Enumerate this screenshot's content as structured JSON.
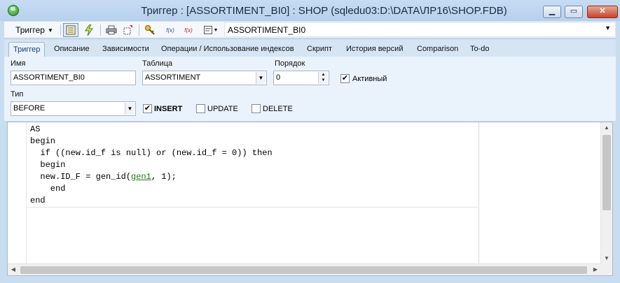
{
  "window": {
    "title": "Триггер : [ASSORTIMENT_BI0] : SHOP (sqledu03:D:\\DATA\\ЛР16\\SHOP.FDB)",
    "min_glyph": "▁",
    "max_glyph": "▭",
    "close_glyph": "✕"
  },
  "toolbar": {
    "trigger_menu_label": "Триггер",
    "object_selector_value": "ASSORTIMENT_BI0",
    "f1_glyph": "f(x)",
    "f2_glyph": "f(x)"
  },
  "tabs": [
    {
      "label": "Триггер",
      "active": true
    },
    {
      "label": "Описание"
    },
    {
      "label": "Зависимости"
    },
    {
      "label": "Операции / Использование индексов"
    },
    {
      "label": "Скрипт"
    },
    {
      "label": "История версий"
    },
    {
      "label": "Comparison"
    },
    {
      "label": "To-do"
    }
  ],
  "form": {
    "name_label": "Имя",
    "name_value": "ASSORTIMENT_BI0",
    "table_label": "Таблица",
    "table_value": "ASSORTIMENT",
    "order_label": "Порядок",
    "order_value": "0",
    "active_label": "Активный",
    "active_checked": true,
    "type_label": "Тип",
    "type_value": "BEFORE",
    "insert_label": "INSERT",
    "insert_checked": true,
    "update_label": "UPDATE",
    "update_checked": false,
    "delete_label": "DELETE",
    "delete_checked": false
  },
  "editor": {
    "lines": [
      "AS",
      "begin",
      "  if ((new.id_f is null) or (new.id_f = 0)) then",
      "  begin",
      "  new.ID_F = gen_id(",
      "    end",
      "end"
    ],
    "gen_link": "gen1",
    "line5_tail": ", 1);"
  }
}
